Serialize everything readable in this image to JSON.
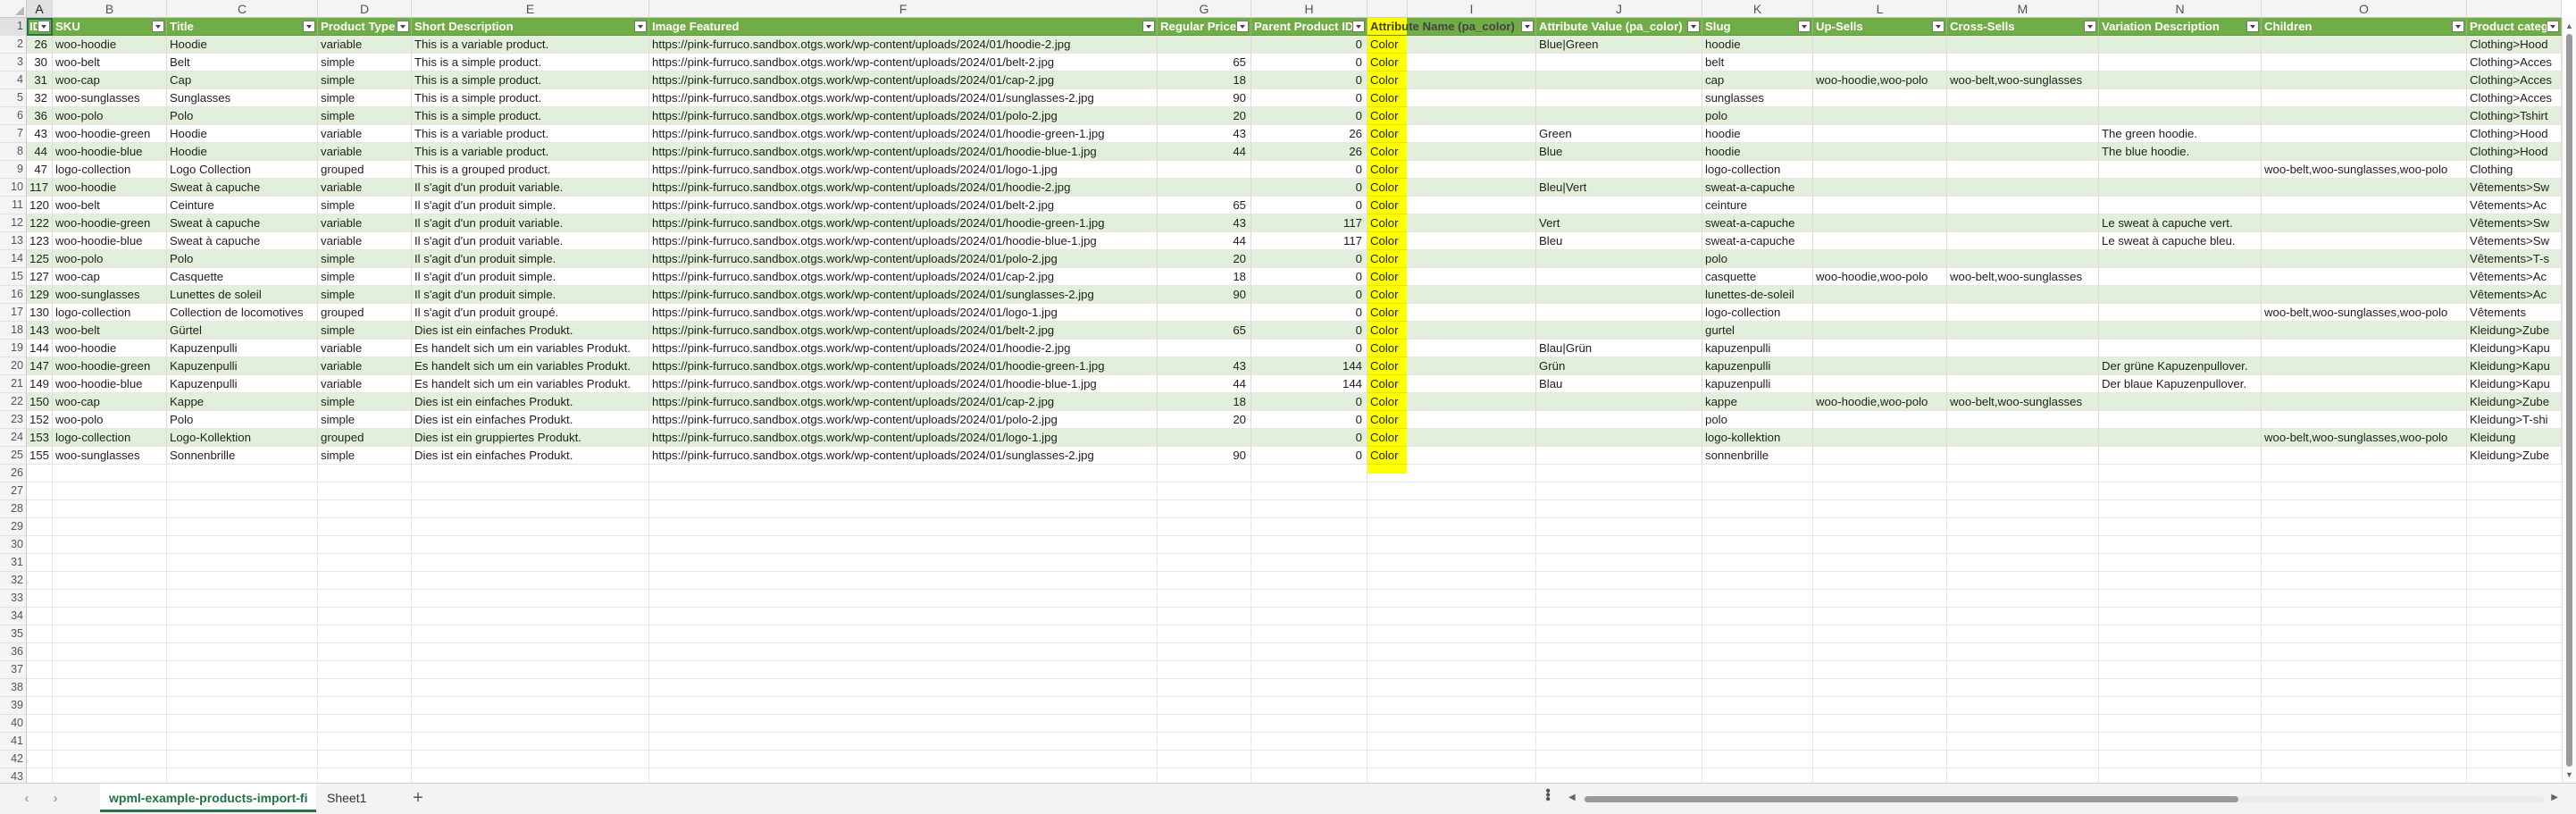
{
  "columns": [
    {
      "letter": "A"
    },
    {
      "letter": "B"
    },
    {
      "letter": "C"
    },
    {
      "letter": "D"
    },
    {
      "letter": "E"
    },
    {
      "letter": "F"
    },
    {
      "letter": "G"
    },
    {
      "letter": "H"
    },
    {
      "letter": ""
    },
    {
      "letter": "I"
    },
    {
      "letter": "J"
    },
    {
      "letter": "K"
    },
    {
      "letter": "L"
    },
    {
      "letter": "M"
    },
    {
      "letter": "N"
    },
    {
      "letter": "O"
    },
    {
      "letter": ""
    }
  ],
  "headers": [
    "ID",
    "SKU",
    "Title",
    "Product Type",
    "Short Description",
    "Image Featured",
    "Regular Price",
    "Parent Product ID",
    "Attribute Name (pa_color)",
    "Attribute Value (pa_color)",
    "Slug",
    "Up-Sells",
    "Cross-Sells",
    "Variation Description",
    "Children",
    "Product catego"
  ],
  "numeric_columns": [
    0,
    6,
    7
  ],
  "highlight_column": 8,
  "rows": [
    [
      "26",
      "woo-hoodie",
      "Hoodie",
      "variable",
      "This is a variable product.",
      "https://pink-furruco.sandbox.otgs.work/wp-content/uploads/2024/01/hoodie-2.jpg",
      "",
      "0",
      "Color",
      "Blue|Green",
      "hoodie",
      "",
      "",
      "",
      "",
      "Clothing>Hood"
    ],
    [
      "30",
      "woo-belt",
      "Belt",
      "simple",
      "This is a simple product.",
      "https://pink-furruco.sandbox.otgs.work/wp-content/uploads/2024/01/belt-2.jpg",
      "65",
      "0",
      "Color",
      "",
      "belt",
      "",
      "",
      "",
      "",
      "Clothing>Acces"
    ],
    [
      "31",
      "woo-cap",
      "Cap",
      "simple",
      "This is a simple product.",
      "https://pink-furruco.sandbox.otgs.work/wp-content/uploads/2024/01/cap-2.jpg",
      "18",
      "0",
      "Color",
      "",
      "cap",
      "woo-hoodie,woo-polo",
      "woo-belt,woo-sunglasses",
      "",
      "",
      "Clothing>Acces"
    ],
    [
      "32",
      "woo-sunglasses",
      "Sunglasses",
      "simple",
      "This is a simple product.",
      "https://pink-furruco.sandbox.otgs.work/wp-content/uploads/2024/01/sunglasses-2.jpg",
      "90",
      "0",
      "Color",
      "",
      "sunglasses",
      "",
      "",
      "",
      "",
      "Clothing>Acces"
    ],
    [
      "36",
      "woo-polo",
      "Polo",
      "simple",
      "This is a simple product.",
      "https://pink-furruco.sandbox.otgs.work/wp-content/uploads/2024/01/polo-2.jpg",
      "20",
      "0",
      "Color",
      "",
      "polo",
      "",
      "",
      "",
      "",
      "Clothing>Tshirt"
    ],
    [
      "43",
      "woo-hoodie-green",
      "Hoodie",
      "variable",
      "This is a variable product.",
      "https://pink-furruco.sandbox.otgs.work/wp-content/uploads/2024/01/hoodie-green-1.jpg",
      "43",
      "26",
      "Color",
      "Green",
      "hoodie",
      "",
      "",
      "The green hoodie.",
      "",
      "Clothing>Hood"
    ],
    [
      "44",
      "woo-hoodie-blue",
      "Hoodie",
      "variable",
      "This is a variable product.",
      "https://pink-furruco.sandbox.otgs.work/wp-content/uploads/2024/01/hoodie-blue-1.jpg",
      "44",
      "26",
      "Color",
      "Blue",
      "hoodie",
      "",
      "",
      "The blue hoodie.",
      "",
      "Clothing>Hood"
    ],
    [
      "47",
      "logo-collection",
      "Logo Collection",
      "grouped",
      "This is a grouped product.",
      "https://pink-furruco.sandbox.otgs.work/wp-content/uploads/2024/01/logo-1.jpg",
      "",
      "0",
      "Color",
      "",
      "logo-collection",
      "",
      "",
      "",
      "woo-belt,woo-sunglasses,woo-polo",
      "Clothing"
    ],
    [
      "117",
      "woo-hoodie",
      "Sweat à capuche",
      "variable",
      "Il s'agit d'un produit variable.",
      "https://pink-furruco.sandbox.otgs.work/wp-content/uploads/2024/01/hoodie-2.jpg",
      "",
      "0",
      "Color",
      "Bleu|Vert",
      "sweat-a-capuche",
      "",
      "",
      "",
      "",
      "Vêtements>Sw"
    ],
    [
      "120",
      "woo-belt",
      "Ceinture",
      "simple",
      "Il s'agit d'un produit simple.",
      "https://pink-furruco.sandbox.otgs.work/wp-content/uploads/2024/01/belt-2.jpg",
      "65",
      "0",
      "Color",
      "",
      "ceinture",
      "",
      "",
      "",
      "",
      "Vêtements>Ac"
    ],
    [
      "122",
      "woo-hoodie-green",
      "Sweat à capuche",
      "variable",
      "Il s'agit d'un produit variable.",
      "https://pink-furruco.sandbox.otgs.work/wp-content/uploads/2024/01/hoodie-green-1.jpg",
      "43",
      "117",
      "Color",
      "Vert",
      "sweat-a-capuche",
      "",
      "",
      "Le sweat à capuche vert.",
      "",
      "Vêtements>Sw"
    ],
    [
      "123",
      "woo-hoodie-blue",
      "Sweat à capuche",
      "variable",
      "Il s'agit d'un produit variable.",
      "https://pink-furruco.sandbox.otgs.work/wp-content/uploads/2024/01/hoodie-blue-1.jpg",
      "44",
      "117",
      "Color",
      "Bleu",
      "sweat-a-capuche",
      "",
      "",
      "Le sweat à capuche bleu.",
      "",
      "Vêtements>Sw"
    ],
    [
      "125",
      "woo-polo",
      "Polo",
      "simple",
      "Il s'agit d'un produit simple.",
      "https://pink-furruco.sandbox.otgs.work/wp-content/uploads/2024/01/polo-2.jpg",
      "20",
      "0",
      "Color",
      "",
      "polo",
      "",
      "",
      "",
      "",
      "Vêtements>T-s"
    ],
    [
      "127",
      "woo-cap",
      "Casquette",
      "simple",
      "Il s'agit d'un produit simple.",
      "https://pink-furruco.sandbox.otgs.work/wp-content/uploads/2024/01/cap-2.jpg",
      "18",
      "0",
      "Color",
      "",
      "casquette",
      "woo-hoodie,woo-polo",
      "woo-belt,woo-sunglasses",
      "",
      "",
      "Vêtements>Ac"
    ],
    [
      "129",
      "woo-sunglasses",
      "Lunettes de soleil",
      "simple",
      "Il s'agit d'un produit simple.",
      "https://pink-furruco.sandbox.otgs.work/wp-content/uploads/2024/01/sunglasses-2.jpg",
      "90",
      "0",
      "Color",
      "",
      "lunettes-de-soleil",
      "",
      "",
      "",
      "",
      "Vêtements>Ac"
    ],
    [
      "130",
      "logo-collection",
      "Collection de locomotives",
      "grouped",
      "Il s'agit d'un produit groupé.",
      "https://pink-furruco.sandbox.otgs.work/wp-content/uploads/2024/01/logo-1.jpg",
      "",
      "0",
      "Color",
      "",
      "logo-collection",
      "",
      "",
      "",
      "woo-belt,woo-sunglasses,woo-polo",
      "Vêtements"
    ],
    [
      "143",
      "woo-belt",
      "Gürtel",
      "simple",
      "Dies ist ein einfaches Produkt.",
      "https://pink-furruco.sandbox.otgs.work/wp-content/uploads/2024/01/belt-2.jpg",
      "65",
      "0",
      "Color",
      "",
      "gurtel",
      "",
      "",
      "",
      "",
      "Kleidung>Zube"
    ],
    [
      "144",
      "woo-hoodie",
      "Kapuzenpulli",
      "variable",
      "Es handelt sich um ein variables Produkt.",
      "https://pink-furruco.sandbox.otgs.work/wp-content/uploads/2024/01/hoodie-2.jpg",
      "",
      "0",
      "Color",
      "Blau|Grün",
      "kapuzenpulli",
      "",
      "",
      "",
      "",
      "Kleidung>Kapu"
    ],
    [
      "147",
      "woo-hoodie-green",
      "Kapuzenpulli",
      "variable",
      "Es handelt sich um ein variables Produkt.",
      "https://pink-furruco.sandbox.otgs.work/wp-content/uploads/2024/01/hoodie-green-1.jpg",
      "43",
      "144",
      "Color",
      "Grün",
      "kapuzenpulli",
      "",
      "",
      "Der grüne Kapuzenpullover.",
      "",
      "Kleidung>Kapu"
    ],
    [
      "149",
      "woo-hoodie-blue",
      "Kapuzenpulli",
      "variable",
      "Es handelt sich um ein variables Produkt.",
      "https://pink-furruco.sandbox.otgs.work/wp-content/uploads/2024/01/hoodie-blue-1.jpg",
      "44",
      "144",
      "Color",
      "Blau",
      "kapuzenpulli",
      "",
      "",
      "Der blaue Kapuzenpullover.",
      "",
      "Kleidung>Kapu"
    ],
    [
      "150",
      "woo-cap",
      "Kappe",
      "simple",
      "Dies ist ein einfaches Produkt.",
      "https://pink-furruco.sandbox.otgs.work/wp-content/uploads/2024/01/cap-2.jpg",
      "18",
      "0",
      "Color",
      "",
      "kappe",
      "woo-hoodie,woo-polo",
      "woo-belt,woo-sunglasses",
      "",
      "",
      "Kleidung>Zube"
    ],
    [
      "152",
      "woo-polo",
      "Polo",
      "simple",
      "Dies ist ein einfaches Produkt.",
      "https://pink-furruco.sandbox.otgs.work/wp-content/uploads/2024/01/polo-2.jpg",
      "20",
      "0",
      "Color",
      "",
      "polo",
      "",
      "",
      "",
      "",
      "Kleidung>T-shi"
    ],
    [
      "153",
      "logo-collection",
      "Logo-Kollektion",
      "grouped",
      "Dies ist ein gruppiertes Produkt.",
      "https://pink-furruco.sandbox.otgs.work/wp-content/uploads/2024/01/logo-1.jpg",
      "",
      "0",
      "Color",
      "",
      "logo-kollektion",
      "",
      "",
      "",
      "woo-belt,woo-sunglasses,woo-polo",
      "Kleidung"
    ],
    [
      "155",
      "woo-sunglasses",
      "Sonnenbrille",
      "simple",
      "Dies ist ein einfaches Produkt.",
      "https://pink-furruco.sandbox.otgs.work/wp-content/uploads/2024/01/sunglasses-2.jpg",
      "90",
      "0",
      "Color",
      "",
      "sonnenbrille",
      "",
      "",
      "",
      "",
      "Kleidung>Zube"
    ]
  ],
  "row_numbers": [
    "1",
    "2",
    "3",
    "4",
    "5",
    "6",
    "7",
    "8",
    "9",
    "10",
    "11",
    "12",
    "13",
    "14",
    "15",
    "16",
    "17",
    "18",
    "19",
    "20",
    "21",
    "22",
    "23",
    "24",
    "25",
    "26",
    "27",
    "28",
    "29",
    "30",
    "31",
    "32",
    "33",
    "34",
    "35",
    "36",
    "37",
    "38",
    "39",
    "40",
    "41",
    "42",
    "43"
  ],
  "tabs": [
    {
      "label": "wpml-example-products-import-fi",
      "active": true
    },
    {
      "label": "Sheet1",
      "active": false
    }
  ],
  "tabbar": {
    "prev": "‹",
    "next": "›",
    "add": "+"
  },
  "colors": {
    "header_green": "#70ad47",
    "band_green": "#e2efda",
    "highlight_yellow": "#ffff00",
    "accent": "#217346"
  }
}
